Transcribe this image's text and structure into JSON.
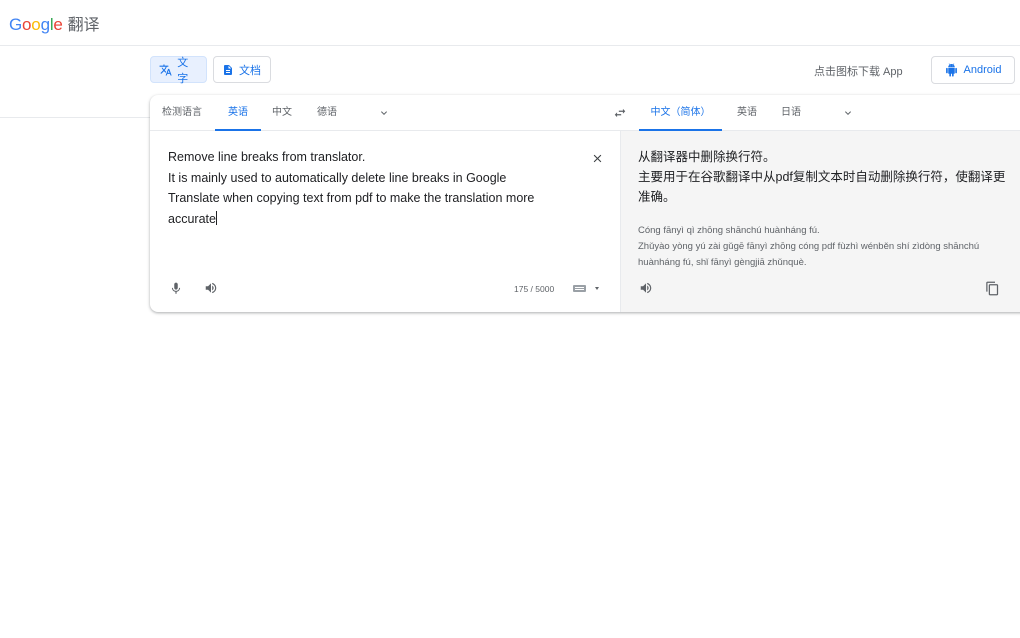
{
  "header": {
    "logo_letters": [
      "G",
      "o",
      "o",
      "g",
      "l",
      "e"
    ],
    "product": "翻译"
  },
  "modes": {
    "text_label": "文字",
    "docs_label": "文档"
  },
  "download": {
    "text": "点击图标下载 App",
    "android_label": "Android"
  },
  "source_langs": {
    "detect": "检测语言",
    "active": "英语",
    "chinese": "中文",
    "german": "德语"
  },
  "target_langs": {
    "active": "中文（简体）",
    "english": "英语",
    "japanese": "日语"
  },
  "source": {
    "line1": "Remove line breaks from translator.",
    "line2": "It is mainly used to automatically delete line breaks in Google",
    "line3": "Translate when copying text from pdf to make the translation more",
    "line4": "accurate",
    "char_count": "175 / 5000"
  },
  "target": {
    "line1": "从翻译器中删除换行符。",
    "line2": "主要用于在谷歌翻译中从pdf复制文本时自动删除换行符，使翻译更",
    "line3": "准确。",
    "rom1": "Cóng fānyì qì zhōng shānchú huànháng fú.",
    "rom2": "Zhǔyào yòng yú zài gǔgē fānyì zhōng cóng pdf fùzhì wénběn shí zìdòng shānchú",
    "rom3": "huànháng fú, shǐ fānyì gèngjiā zhǔnquè."
  },
  "colors": {
    "accent": "#1a73e8",
    "icon": "#5f6368",
    "target_bg": "#f5f5f5"
  },
  "icons": [
    "translate-icon",
    "document-icon",
    "android-icon",
    "chevron-down-icon",
    "swap-icon",
    "close-icon",
    "mic-icon",
    "speaker-icon",
    "keyboard-icon",
    "copy-icon"
  ]
}
